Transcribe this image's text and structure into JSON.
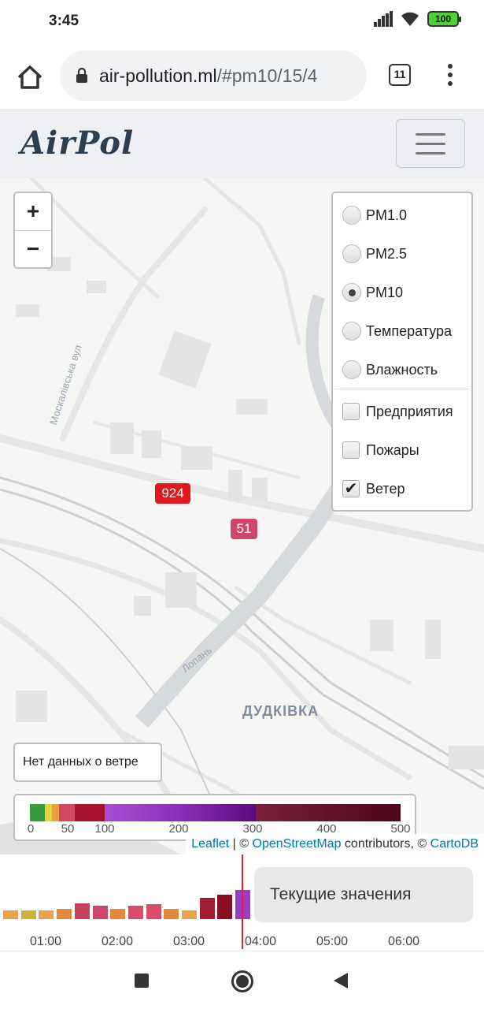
{
  "status": {
    "time": "3:45",
    "battery": "100",
    "icons": [
      "signal-icon",
      "wifi-icon",
      "battery-icon"
    ]
  },
  "browser": {
    "url_host": "air-pollution.ml",
    "url_path": "/#pm10/15/4",
    "tab_count": "11",
    "icons": [
      "home-icon",
      "lock-icon",
      "tabs-icon",
      "more-vert-icon"
    ]
  },
  "app": {
    "brand": "AirPol",
    "menu_icon": "hamburger-icon"
  },
  "map": {
    "zoom_in": "+",
    "zoom_out": "−",
    "layers": {
      "radios": [
        {
          "label": "PM1.0",
          "checked": false
        },
        {
          "label": "PM2.5",
          "checked": false
        },
        {
          "label": "PM10",
          "checked": true
        },
        {
          "label": "Температура",
          "checked": false
        },
        {
          "label": "Влажность",
          "checked": false
        }
      ],
      "checkboxes": [
        {
          "label": "Предприятия",
          "checked": false
        },
        {
          "label": "Пожары",
          "checked": false
        },
        {
          "label": "Ветер",
          "checked": true
        }
      ]
    },
    "markers": [
      {
        "value": "924",
        "color": "#e3171e"
      },
      {
        "value": "51",
        "color": "#d1466b"
      }
    ],
    "place_label": "ДУДКІВКА",
    "streets": [
      "Москалівська вул",
      "Лопань"
    ],
    "wind_info": "Нет данных о ветре",
    "legend": {
      "colors": [
        "#3a9a3e",
        "#e3d43c",
        "#e8a03a",
        "#d04a61",
        "#a81430",
        "#a64fd2",
        "#8a2fb8",
        "#5b0a7e",
        "#7b1f3a",
        "#4c0519"
      ],
      "ticks": [
        "0",
        "50",
        "100",
        "200",
        "300",
        "400",
        "500"
      ]
    },
    "attribution": {
      "leaflet": "Leaflet",
      "sep": " | © ",
      "osm": "OpenStreetMap",
      "mid": " contributors, © ",
      "carto": "CartoDB"
    }
  },
  "timeline": {
    "labels": [
      "01:00",
      "02:00",
      "03:00",
      "04:00",
      "05:00",
      "06:00"
    ],
    "bars": [
      {
        "level": 0.18,
        "color": "#e9a24a"
      },
      {
        "level": 0.18,
        "color": "#cfb23a"
      },
      {
        "level": 0.19,
        "color": "#e9a24a"
      },
      {
        "level": 0.22,
        "color": "#e28a3c"
      },
      {
        "level": 0.33,
        "color": "#c8415c"
      },
      {
        "level": 0.29,
        "color": "#d1466b"
      },
      {
        "level": 0.22,
        "color": "#e28a3c"
      },
      {
        "level": 0.29,
        "color": "#d84d6a"
      },
      {
        "level": 0.31,
        "color": "#d84d6a"
      },
      {
        "level": 0.22,
        "color": "#e28a3c"
      },
      {
        "level": 0.18,
        "color": "#e9a24a"
      },
      {
        "level": 0.45,
        "color": "#a21c32"
      },
      {
        "level": 0.51,
        "color": "#8a0e22"
      },
      {
        "level": 0.61,
        "color": "#9c3bc7"
      }
    ],
    "current_button": "Текущие значения"
  },
  "android_nav": [
    "recents-icon",
    "home-icon",
    "back-icon"
  ]
}
